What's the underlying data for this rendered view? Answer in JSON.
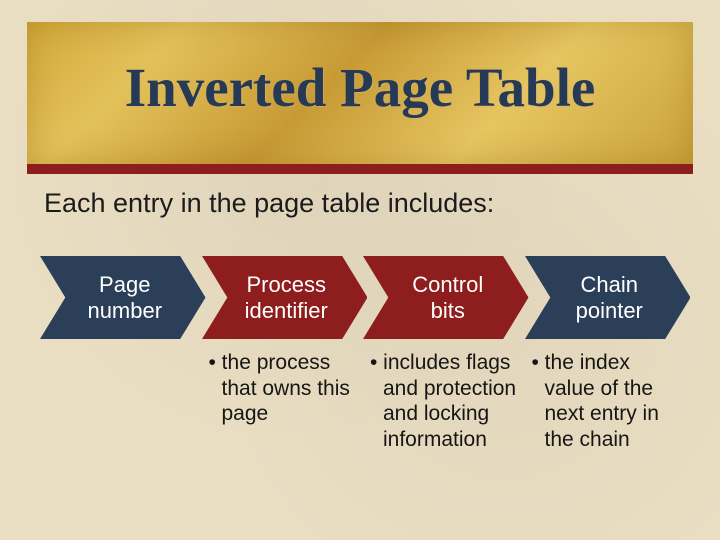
{
  "title": "Inverted Page Table",
  "subhead": "Each entry in the page table includes:",
  "items": [
    {
      "label": "Page number",
      "fill": "#2b3f59",
      "desc": ""
    },
    {
      "label": "Process identifier",
      "fill": "#8e1d1d",
      "desc": "• the process that owns this page"
    },
    {
      "label": "Control bits",
      "fill": "#8e1d1d",
      "desc": "• includes flags and protection and locking information"
    },
    {
      "label": "Chain pointer",
      "fill": "#2b3f59",
      "desc": "• the index value of the next entry in the chain"
    }
  ]
}
